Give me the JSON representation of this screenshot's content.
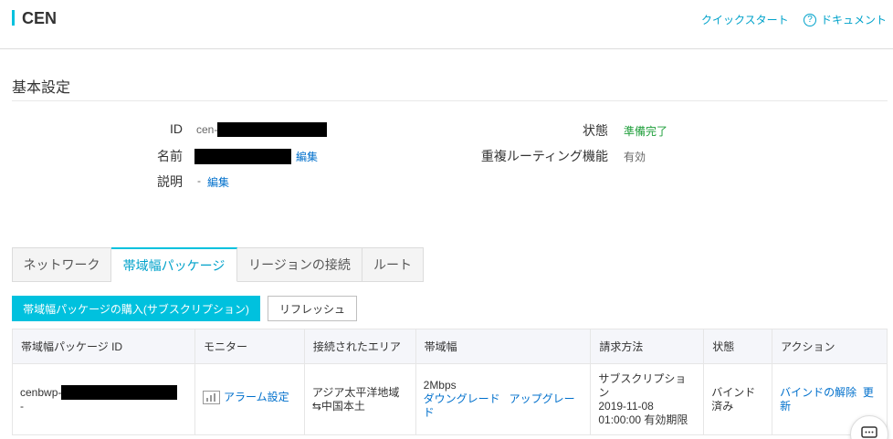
{
  "header": {
    "title": "CEN",
    "quick_start": "クイックスタート",
    "docs": "ドキュメント"
  },
  "basic": {
    "section_title": "基本設定",
    "id_label": "ID",
    "id_prefix": "cen-",
    "name_label": "名前",
    "edit": "編集",
    "desc_label": "説明",
    "desc_value": "-",
    "status_label": "状態",
    "status_value": "準備完了",
    "routing_label": "重複ルーティング機能",
    "routing_value": "有効"
  },
  "tabs": [
    {
      "label": "ネットワーク"
    },
    {
      "label": "帯域幅パッケージ"
    },
    {
      "label": "リージョンの接続"
    },
    {
      "label": "ルート"
    }
  ],
  "actions": {
    "buy": "帯域幅パッケージの購入(サブスクリプション)",
    "refresh": "リフレッシュ"
  },
  "table": {
    "headers": [
      "帯域幅パッケージ ID",
      "モニター",
      "接続されたエリア",
      "帯域幅",
      "請求方法",
      "状態",
      "アクション"
    ],
    "row": {
      "id_prefix": "cenbwp-",
      "id_suffix": "-",
      "alarm": "アラーム設定",
      "area_line1": "アジア太平洋地域",
      "area_line2": "⇆中国本土",
      "bandwidth": "2Mbps",
      "downgrade": "ダウングレード",
      "upgrade": "アップグレード",
      "billing_line1": "サブスクリプション",
      "billing_line2": "2019-11-08",
      "billing_line3": "01:00:00 有効期限",
      "status": "バインド済み",
      "unbind": "バインドの解除",
      "renew": "更新"
    }
  },
  "colors": {
    "accent": "#00c1de",
    "link": "#0070cc",
    "success": "#1e9e3a"
  }
}
